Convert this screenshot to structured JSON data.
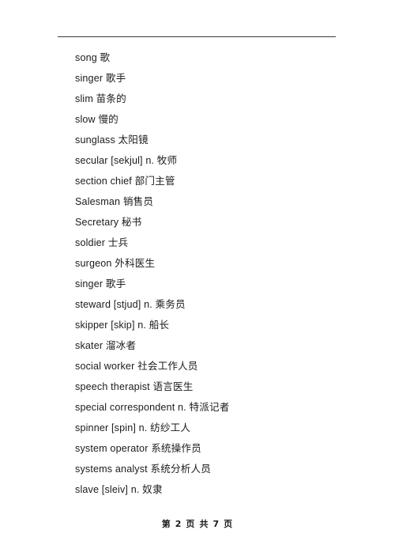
{
  "page": {
    "background_color": "#ffffff",
    "text_color": "#1b1b1b",
    "rule_color": "#3a3a3a"
  },
  "header": {
    "rule": "horizontal-rule"
  },
  "vocabulary": {
    "entries": [
      {
        "text": "song 歌"
      },
      {
        "text": "singer 歌手"
      },
      {
        "text": "slim 苗条的"
      },
      {
        "text": "slow 慢的"
      },
      {
        "text": "sunglass 太阳镜"
      },
      {
        "text": "secular [sekjul] n. 牧师"
      },
      {
        "text": "section chief  部门主管"
      },
      {
        "text": "Salesman 销售员"
      },
      {
        "text": "Secretary 秘书"
      },
      {
        "text": "soldier 士兵"
      },
      {
        "text": "surgeon 外科医生"
      },
      {
        "text": "singer 歌手"
      },
      {
        "text": "steward [stjud] n. 乘务员"
      },
      {
        "text": "skipper [skip] n. 船长"
      },
      {
        "text": "skater 溜冰者"
      },
      {
        "text": "social worker 社会工作人员"
      },
      {
        "text": "speech therapist 语言医生"
      },
      {
        "text": "special correspondent n. 特派记者"
      },
      {
        "text": "spinner [spin] n. 纺纱工人"
      },
      {
        "text": "system operator 系统操作员"
      },
      {
        "text": "systems analyst 系统分析人员"
      },
      {
        "text": "slave [sleiv] n. 奴隶"
      }
    ]
  },
  "footer": {
    "page_label": "第 2 页 共 7 页",
    "current_page": 2,
    "total_pages": 7
  }
}
